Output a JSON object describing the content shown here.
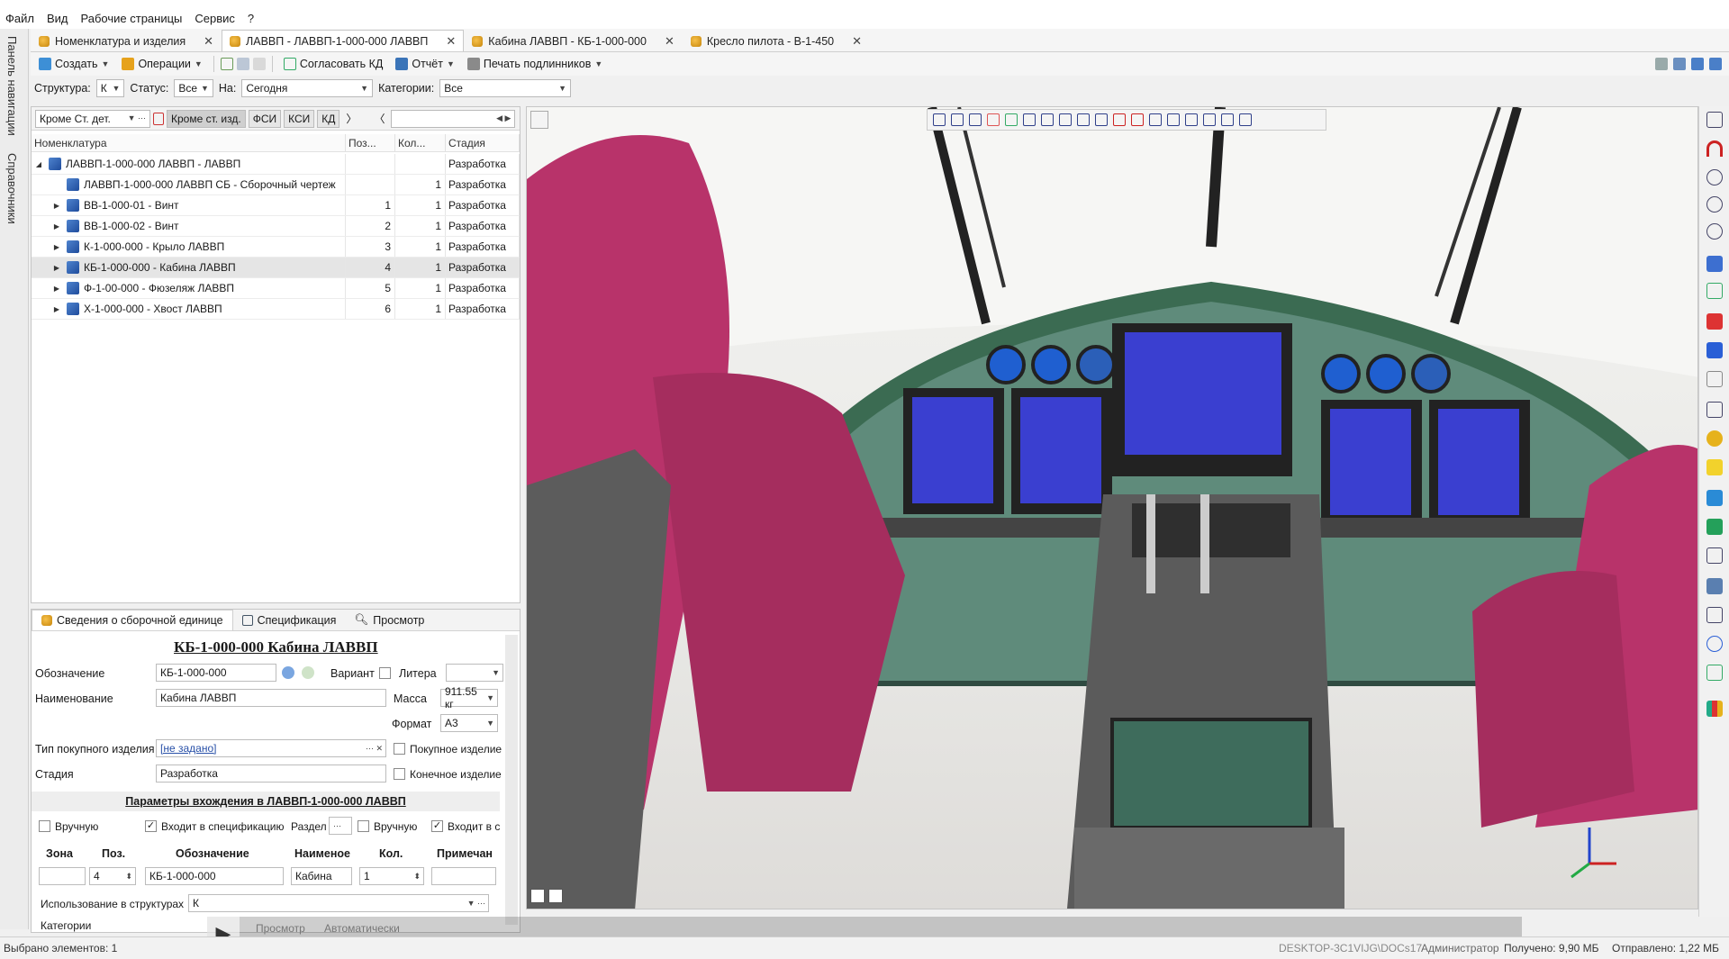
{
  "menu": [
    "Файл",
    "Вид",
    "Рабочие страницы",
    "Сервис",
    "?"
  ],
  "tabs": [
    {
      "label": "Номенклатура и изделия",
      "active": false
    },
    {
      "label": "ЛАВВП - ЛАВВП-1-000-000 ЛАВВП",
      "active": true
    },
    {
      "label": "Кабина ЛАВВП - КБ-1-000-000",
      "active": false
    },
    {
      "label": "Кресло пилота - В-1-450",
      "active": false
    }
  ],
  "left_tabs": [
    "Панель навигации",
    "Справочники"
  ],
  "toolbar": {
    "create": "Создать",
    "operations": "Операции",
    "approve": "Согласовать КД",
    "report": "Отчёт",
    "print": "Печать подлинников"
  },
  "filter": {
    "structure_label": "Структура:",
    "structure_value": "К",
    "status_label": "Статус:",
    "status_value": "Все",
    "on_label": "На:",
    "on_value": "Сегодня",
    "categories_label": "Категории:",
    "categories_value": "Все"
  },
  "tree_tools": {
    "combo": "Кроме Ст. дет.",
    "btn1": "Кроме ст. изд.",
    "btn2": "ФСИ",
    "btn3": "КСИ",
    "btn4": "КД"
  },
  "tree_headers": [
    "Номенклатура",
    "Поз...",
    "Кол...",
    "Стадия"
  ],
  "tree_rows": [
    {
      "name": "ЛАВВП-1-000-000 ЛАВВП - ЛАВВП",
      "pos": "",
      "qty": "",
      "stage": "Разработка",
      "level": 0,
      "exp": "◢",
      "sel": false
    },
    {
      "name": "ЛАВВП-1-000-000 ЛАВВП СБ - Сборочный чертеж",
      "pos": "",
      "qty": "1",
      "stage": "Разработка",
      "level": 1,
      "exp": "",
      "sel": false
    },
    {
      "name": "ВВ-1-000-01 - Винт",
      "pos": "1",
      "qty": "1",
      "stage": "Разработка",
      "level": 1,
      "exp": "▶",
      "sel": false
    },
    {
      "name": "ВВ-1-000-02 - Винт",
      "pos": "2",
      "qty": "1",
      "stage": "Разработка",
      "level": 1,
      "exp": "▶",
      "sel": false
    },
    {
      "name": "К-1-000-000 - Крыло ЛАВВП",
      "pos": "3",
      "qty": "1",
      "stage": "Разработка",
      "level": 1,
      "exp": "▶",
      "sel": false
    },
    {
      "name": "КБ-1-000-000 - Кабина ЛАВВП",
      "pos": "4",
      "qty": "1",
      "stage": "Разработка",
      "level": 1,
      "exp": "▶",
      "sel": true
    },
    {
      "name": "Ф-1-00-000 - Фюзеляж ЛАВВП",
      "pos": "5",
      "qty": "1",
      "stage": "Разработка",
      "level": 1,
      "exp": "▶",
      "sel": false
    },
    {
      "name": "Х-1-000-000 - Хвост ЛАВВП",
      "pos": "6",
      "qty": "1",
      "stage": "Разработка",
      "level": 1,
      "exp": "▶",
      "sel": false
    }
  ],
  "props": {
    "tabs": [
      "Сведения о сборочной единице",
      "Спецификация",
      "Просмотр"
    ],
    "title": "КБ-1-000-000 Кабина ЛАВВП",
    "designation_label": "Обозначение",
    "designation_value": "КБ-1-000-000",
    "variant_label": "Вариант",
    "litera_label": "Литера",
    "name_label": "Наименование",
    "name_value": "Кабина ЛАВВП",
    "mass_label": "Масса",
    "mass_value": "911.55 кг",
    "format_label": "Формат",
    "format_value": "А3",
    "purchase_type_label": "Тип покупного изделия",
    "purchase_type_value": "[не задано]",
    "purchased_label": "Покупное изделие",
    "stage_label": "Стадия",
    "stage_value": "Разработка",
    "final_label": "Конечное изделие",
    "params_title": "Параметры вхождения в ЛАВВП-1-000-000 ЛАВВП",
    "manual_label": "Вручную",
    "in_spec_label": "Входит в спецификацию",
    "section_label": "Раздел",
    "manual2_label": "Вручную",
    "in_c_label": "Входит в с",
    "grid_headers": [
      "Зона",
      "Поз.",
      "Обозначение",
      "Наименое",
      "Кол.",
      "Примечан"
    ],
    "grid_values": [
      "",
      "4",
      "КБ-1-000-000",
      "Кабина",
      "1",
      ""
    ],
    "usage_label": "Использование в структурах",
    "usage_value": "К",
    "categories_label": "Категории"
  },
  "viewport_bottom": {
    "view_label": "Просмотр",
    "auto_label": "Автоматически"
  },
  "status": {
    "selected": "Выбрано элементов: 1",
    "host": "DESKTOP-3C1VIJG\\DOCs17",
    "user": "Администратор",
    "received": "Получено: 9,90 МБ",
    "sent": "Отправлено: 1,22 МБ"
  },
  "colors": {
    "seat": "#b8336a",
    "panel": "#5f8b7b",
    "screen": "#3a3fd0",
    "accent": "#1f4c9c"
  }
}
